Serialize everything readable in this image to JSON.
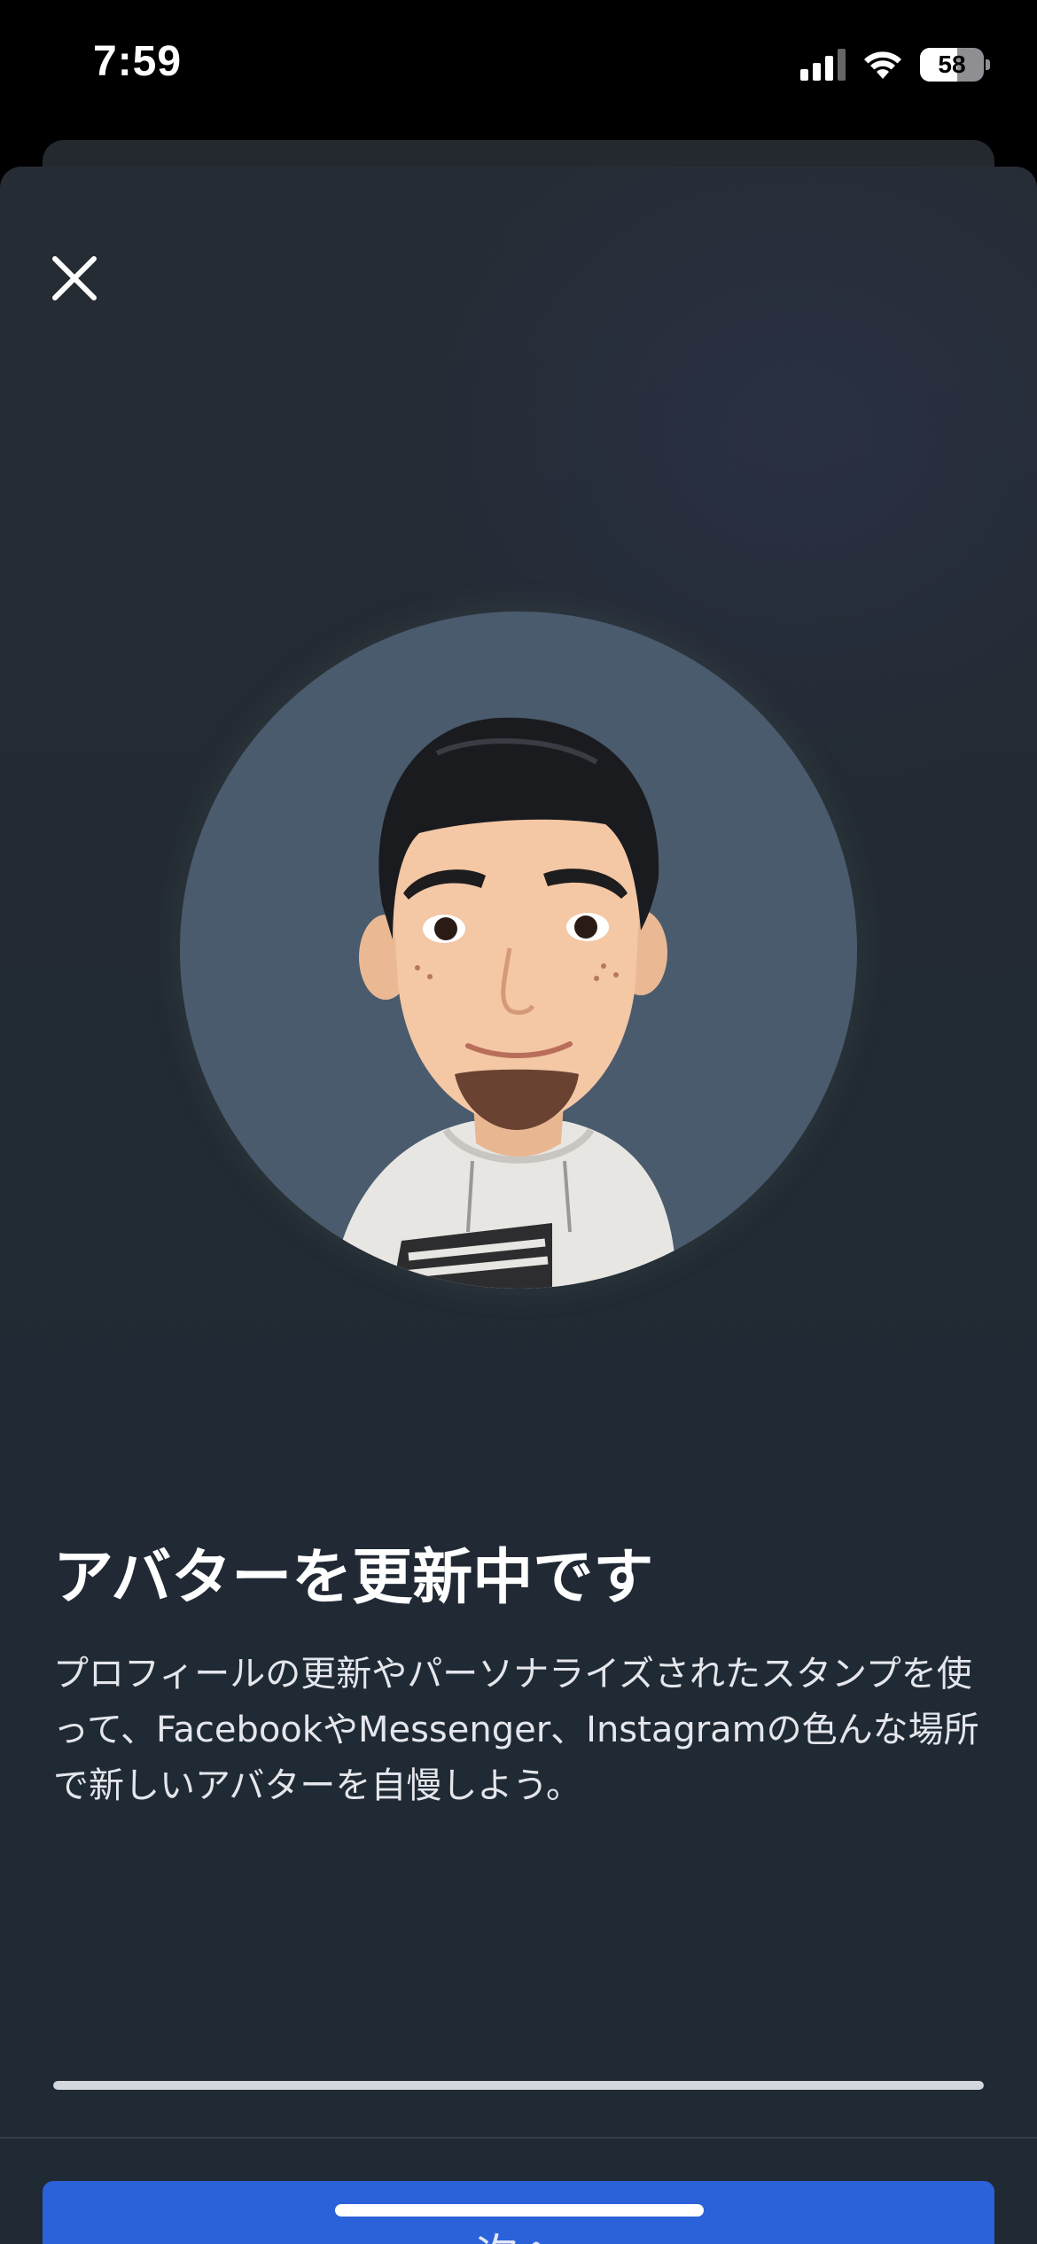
{
  "status_bar": {
    "time": "7:59",
    "battery_level": "58",
    "battery_fraction": 0.58,
    "icons": [
      "signal-icon",
      "wifi-icon",
      "battery-icon"
    ]
  },
  "sheet": {
    "close_icon": "close-icon",
    "avatar_alt": "avatar-image",
    "headline": "アバターを更新中です",
    "description": "プロフィールの更新やパーソナライズされたスタンプを使って、FacebookやMessenger、Instagramの色んな場所で新しいアバターを自慢しよう。",
    "progress": 1.0,
    "next_button_label": "次へ"
  },
  "colors": {
    "accent_button": "#2b62d9",
    "avatar_background": "#4a5b6d",
    "sheet_background": "#232b34"
  }
}
